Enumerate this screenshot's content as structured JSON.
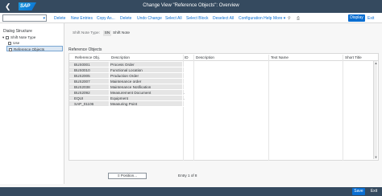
{
  "shell": {
    "title": "Change View \"Reference Objects\": Overview",
    "logo": "SAP"
  },
  "toolbar": {
    "buttons": [
      "Delete",
      "New Entries",
      "Copy As...",
      "Delete",
      "Undo Change",
      "Select All",
      "Select Block",
      "Deselect All",
      "Configuration Help",
      "More"
    ],
    "display": "Display",
    "exit": "Exit"
  },
  "left": {
    "title": "Dialog Structure",
    "folder": "Shift Note Type",
    "use": "Use",
    "refobj": "Reference Objects"
  },
  "main": {
    "snt_label": "Shift Note Type:",
    "snt_value": "SN",
    "snt_desc": "Shift Note",
    "section": "Reference Objects",
    "headers": [
      "Reference Obj.",
      "Description",
      "ID",
      "Description",
      "Text Name",
      "Short Title"
    ],
    "rows": [
      {
        "obj": "BUS0001",
        "desc": "Process Order",
        "id": ""
      },
      {
        "obj": "BUS0010",
        "desc": "Functional Location",
        "id": ""
      },
      {
        "obj": "BUS2005",
        "desc": "Production Order",
        "id": ""
      },
      {
        "obj": "BUS2007",
        "desc": "Maintenance order",
        "id": ""
      },
      {
        "obj": "BUS2038",
        "desc": "Maintenance Notification",
        "id": ""
      },
      {
        "obj": "BUS2092",
        "desc": "Measurement Document",
        "id": "."
      },
      {
        "obj": "EQUI",
        "desc": "Equipment",
        "id": "."
      },
      {
        "obj": "SAP_01106",
        "desc": "Measuring Point",
        "id": ""
      }
    ],
    "position_btn": "Position...",
    "entry": "Entry 1 of 8"
  },
  "footer": {
    "save": "Save",
    "exit": "Exit"
  }
}
